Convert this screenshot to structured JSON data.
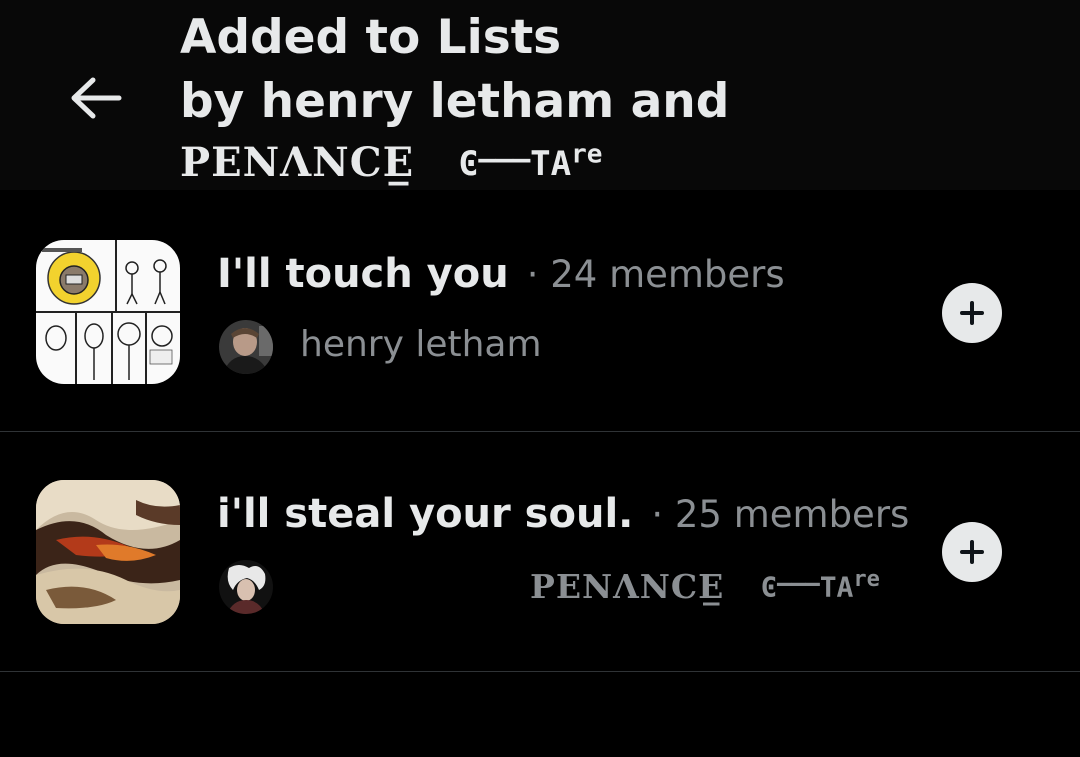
{
  "header": {
    "back_label": "Back",
    "title_line1": "Added to Lists",
    "title_line2": "by henry letham and",
    "title_name_styled": "PENΛNCE̲",
    "title_tag_styled": "ϾⲻⲻⲻTA",
    "title_tag_sup": "re"
  },
  "lists": [
    {
      "name": "I'll touch you",
      "meta": "· 24 members",
      "owner_name": "henry letham",
      "thumb_icon": "comic-strip-thumbnail",
      "avatar_icon": "user-avatar"
    },
    {
      "name": "i'll steal your soul.",
      "meta": "· 25 members",
      "owner_name_styled": "PENΛNCE̲",
      "owner_tag_styled": "ϾⲻⲻⲻTA",
      "owner_tag_sup": "re",
      "thumb_icon": "abstract-art-thumbnail",
      "avatar_icon": "user-avatar"
    }
  ],
  "icons": {
    "back": "arrow-left-icon",
    "add": "plus-icon"
  },
  "colors": {
    "background": "#000000",
    "header_bg": "#080808",
    "primary_text": "#e7e9ea",
    "secondary_text": "#8b8f93",
    "divider": "#2f3336",
    "add_button_bg": "#e7e9ea"
  }
}
